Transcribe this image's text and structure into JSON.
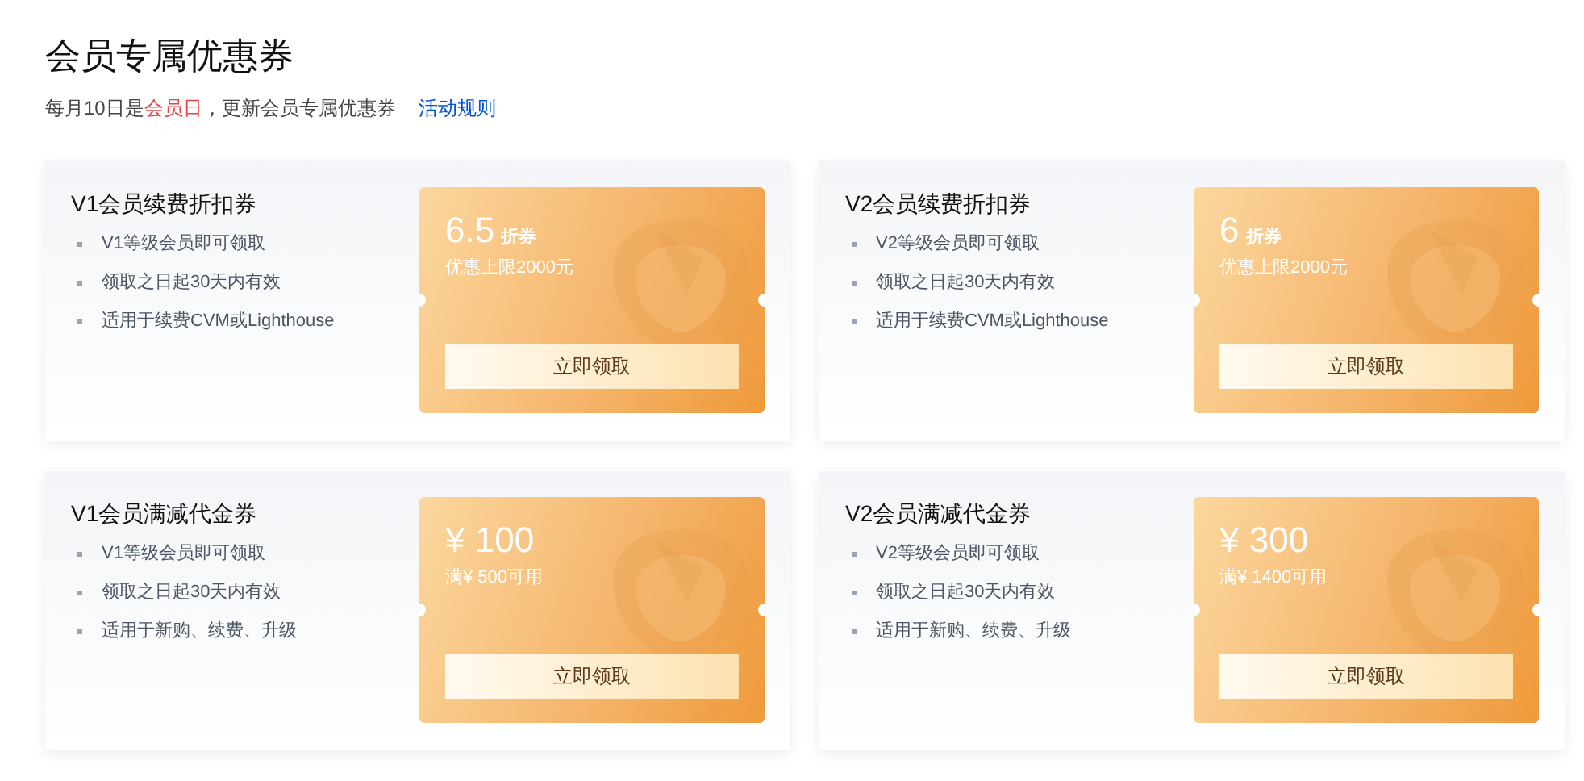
{
  "title": "会员专属优惠券",
  "subtitle": {
    "before": "每月10日是",
    "highlight": "会员日",
    "after": "，更新会员专属优惠券"
  },
  "rules_link": "活动规则",
  "coupons": [
    {
      "title": "V1会员续费折扣券",
      "bullets": [
        "V1等级会员即可领取",
        "领取之日起30天内有效",
        "适用于续费CVM或Lighthouse"
      ],
      "value": "6.5",
      "unit": "折券",
      "condition": "优惠上限2000元",
      "button": "立即领取"
    },
    {
      "title": "V2会员续费折扣券",
      "bullets": [
        "V2等级会员即可领取",
        "领取之日起30天内有效",
        "适用于续费CVM或Lighthouse"
      ],
      "value": "6",
      "unit": "折券",
      "condition": "优惠上限2000元",
      "button": "立即领取"
    },
    {
      "title": "V1会员满减代金券",
      "bullets": [
        "V1等级会员即可领取",
        "领取之日起30天内有效",
        "适用于新购、续费、升级"
      ],
      "value": "¥ 100",
      "condition": "满¥ 500可用",
      "button": "立即领取"
    },
    {
      "title": "V2会员满减代金券",
      "bullets": [
        "V2等级会员即可领取",
        "领取之日起30天内有效",
        "适用于新购、续费、升级"
      ],
      "value": "¥ 300",
      "condition": "满¥ 1400可用",
      "button": "立即领取"
    }
  ]
}
